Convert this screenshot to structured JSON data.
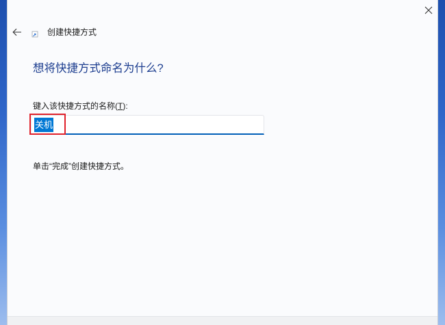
{
  "window": {
    "title": "创建快捷方式",
    "close_icon": "close-icon",
    "back_icon": "back-arrow-icon",
    "app_icon": "shortcut-icon"
  },
  "page": {
    "heading": "想将快捷方式命名为什么?",
    "name_label": {
      "before": "键入该快捷方式的名称(",
      "access_key": "T",
      "after": "):"
    },
    "name_value": "关机",
    "instruction": "单击“完成”创建快捷方式。"
  },
  "colors": {
    "heading": "#1c3d8f",
    "selection": "#0078d4",
    "focus": "#005fb8",
    "annotation": "#e0202a"
  }
}
